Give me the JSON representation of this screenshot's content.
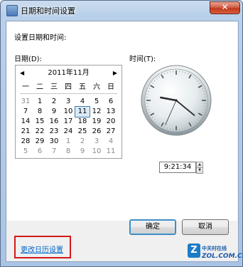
{
  "window": {
    "title": "日期和时间设置",
    "close_glyph": "✕"
  },
  "dialog": {
    "heading": "设置日期和时间:",
    "date_label": "日期(D):",
    "time_label": "时间(T):"
  },
  "calendar": {
    "prev_glyph": "◀",
    "next_glyph": "▶",
    "month_title": "2011年11月",
    "weekdays": [
      "一",
      "二",
      "三",
      "四",
      "五",
      "六",
      "日"
    ],
    "selected_day": "11",
    "weeks": [
      [
        {
          "d": "31",
          "dim": true
        },
        {
          "d": "1"
        },
        {
          "d": "2"
        },
        {
          "d": "3"
        },
        {
          "d": "4"
        },
        {
          "d": "5"
        },
        {
          "d": "6"
        }
      ],
      [
        {
          "d": "7"
        },
        {
          "d": "8"
        },
        {
          "d": "9"
        },
        {
          "d": "10"
        },
        {
          "d": "11",
          "sel": true
        },
        {
          "d": "12"
        },
        {
          "d": "13"
        }
      ],
      [
        {
          "d": "14"
        },
        {
          "d": "15"
        },
        {
          "d": "16"
        },
        {
          "d": "17"
        },
        {
          "d": "18"
        },
        {
          "d": "19"
        },
        {
          "d": "20"
        }
      ],
      [
        {
          "d": "21"
        },
        {
          "d": "22"
        },
        {
          "d": "23"
        },
        {
          "d": "24"
        },
        {
          "d": "25"
        },
        {
          "d": "26"
        },
        {
          "d": "27"
        }
      ],
      [
        {
          "d": "28"
        },
        {
          "d": "29"
        },
        {
          "d": "30"
        },
        {
          "d": "1",
          "dim": true
        },
        {
          "d": "2",
          "dim": true
        },
        {
          "d": "3",
          "dim": true
        },
        {
          "d": "4",
          "dim": true
        }
      ],
      [
        {
          "d": "5",
          "dim": true
        },
        {
          "d": "6",
          "dim": true
        },
        {
          "d": "7",
          "dim": true
        },
        {
          "d": "8",
          "dim": true
        },
        {
          "d": "9",
          "dim": true
        },
        {
          "d": "10",
          "dim": true
        },
        {
          "d": "11",
          "dim": true
        }
      ]
    ]
  },
  "clock": {
    "time_value": "9:21:34",
    "hour": 9,
    "minute": 21,
    "second": 34
  },
  "spinner": {
    "up_glyph": "▲",
    "down_glyph": "▼"
  },
  "links": {
    "change_calendar": "更改日历设置"
  },
  "buttons": {
    "ok": "确定",
    "cancel": "取消"
  },
  "watermark": {
    "mark": "Z",
    "line1": "中关村在线",
    "line2": "ZOL.COM.CN"
  },
  "colors": {
    "link": "#0066cc",
    "highlight_box": "#d21a1a",
    "close_button": "#c0391b"
  }
}
